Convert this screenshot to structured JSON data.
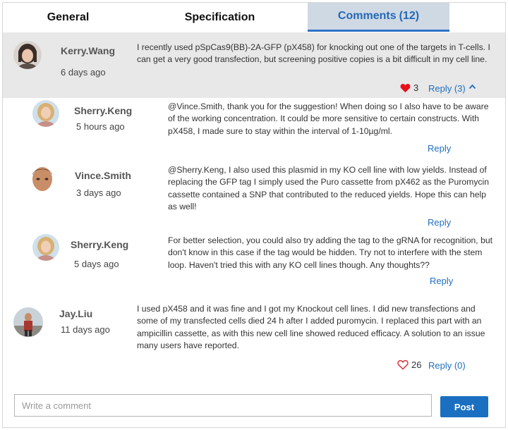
{
  "tabs": {
    "general": "General",
    "specification": "Specification",
    "comments": "Comments",
    "comments_count": "(12)"
  },
  "top_comment": {
    "author": "Kerry.Wang",
    "time": "6 days ago",
    "text_lines": [
      "I recently used pSpCas9(BB)-2A-GFP (pX458) for knocking out one of the targets in T-cells. I",
      "can get a very good transfection, but screening positive copies is a bit difficult in my cell line."
    ],
    "likes": "3",
    "reply_label": "Reply (3)",
    "heart_color": "#e8101a"
  },
  "replies": [
    {
      "author": "Sherry.Keng",
      "time": "5 hours ago",
      "text_lines": [
        "@Vince.Smith, thank you for the suggestion! When doing so I also have to be aware",
        "of the working concentration. It could be more sensitive to certain constructs. With",
        "pX458, I made sure to stay within the interval of 1-10µg/ml."
      ],
      "reply_label": "Reply"
    },
    {
      "author": "Vince.Smith",
      "time": "3 days ago",
      "text_lines": [
        "@Sherry.Keng, I also used this plasmid in my KO cell line with low yields. Instead of",
        "replacing the GFP tag I simply used the Puro cassette from pX462 as the Puromycin",
        "cassette contained a SNP that contributed to the reduced yields. Hope this can help",
        "as well!"
      ],
      "reply_label": "Reply"
    },
    {
      "author": "Sherry.Keng",
      "time": "5 days ago",
      "text_lines": [
        "For better selection, you could also try adding the tag to the gRNA for recognition, but",
        "don't know in this case if the tag would be hidden. Try not to interfere with the stem",
        "loop. Haven't tried this with any KO cell lines though. Any thoughts??"
      ],
      "reply_label": "Reply"
    }
  ],
  "bottom_comment": {
    "author": "Jay.Liu",
    "time": "11 days ago",
    "text_lines": [
      "I used pX458 and it was fine and I got my Knockout cell lines. I did new transfections and",
      "some of my transfected cells died 24 h after I added puromycin. I replaced this part with an",
      "ampicillin cassette, as with this new cell line showed reduced efficacy. A solution to an issue",
      "many users have reported."
    ],
    "likes": "26",
    "reply_label": "Reply (0)",
    "heart_color": "#d9282f"
  },
  "composer": {
    "placeholder": "Write a comment",
    "post_label": "Post",
    "accent": "#1a6fc1"
  }
}
